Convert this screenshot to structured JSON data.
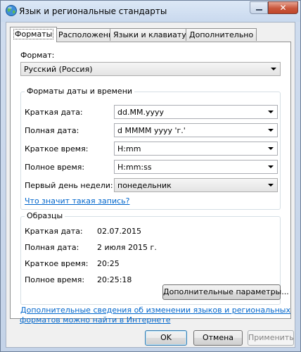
{
  "window": {
    "title": "Язык и региональные стандарты",
    "close_glyph": "✕"
  },
  "tabs": [
    {
      "label": "Форматы",
      "active": true
    },
    {
      "label": "Расположение",
      "active": false
    },
    {
      "label": "Языки и клавиатуры",
      "active": false
    },
    {
      "label": "Дополнительно",
      "active": false
    }
  ],
  "format": {
    "label": "Формат:",
    "value": "Русский (Россия)"
  },
  "datetime": {
    "title": "Форматы даты и времени",
    "short_date": {
      "label": "Краткая дата:",
      "value": "dd.MM.yyyy"
    },
    "long_date": {
      "label": "Полная дата:",
      "value": "d MMMM yyyy 'г.'"
    },
    "short_time": {
      "label": "Краткое время:",
      "value": "H:mm"
    },
    "long_time": {
      "label": "Полное время:",
      "value": "H:mm:ss"
    },
    "first_day": {
      "label": "Первый день недели:",
      "value": "понедельник"
    },
    "help_link": "Что значит такая запись?"
  },
  "samples": {
    "title": "Образцы",
    "short_date": {
      "label": "Краткая дата:",
      "value": "02.07.2015"
    },
    "long_date": {
      "label": "Полная дата:",
      "value": "2 июля 2015 г."
    },
    "short_time": {
      "label": "Краткое время:",
      "value": "20:25"
    },
    "long_time": {
      "label": "Полное время:",
      "value": "20:25:18"
    }
  },
  "additional_button": "Дополнительные параметры...",
  "info_link": {
    "line1": "Дополнительные сведения об изменении языков и региональных",
    "line2": "форматов можно найти в Интернете"
  },
  "buttons": {
    "ok": "OK",
    "cancel": "Отмена",
    "apply": "Применить"
  }
}
